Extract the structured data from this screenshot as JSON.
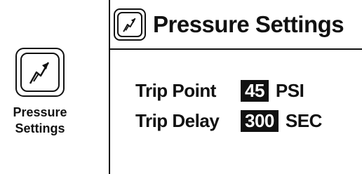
{
  "launcher": {
    "icon": "pressure-gauge-arrow-icon",
    "label_line1": "Pressure",
    "label_line2": "Settings"
  },
  "panel": {
    "icon": "pressure-gauge-arrow-icon",
    "title": "Pressure Settings",
    "rows": [
      {
        "label": "Trip Point",
        "value": "45",
        "unit": "PSI"
      },
      {
        "label": "Trip Delay",
        "value": "300",
        "unit": "SEC"
      }
    ]
  }
}
